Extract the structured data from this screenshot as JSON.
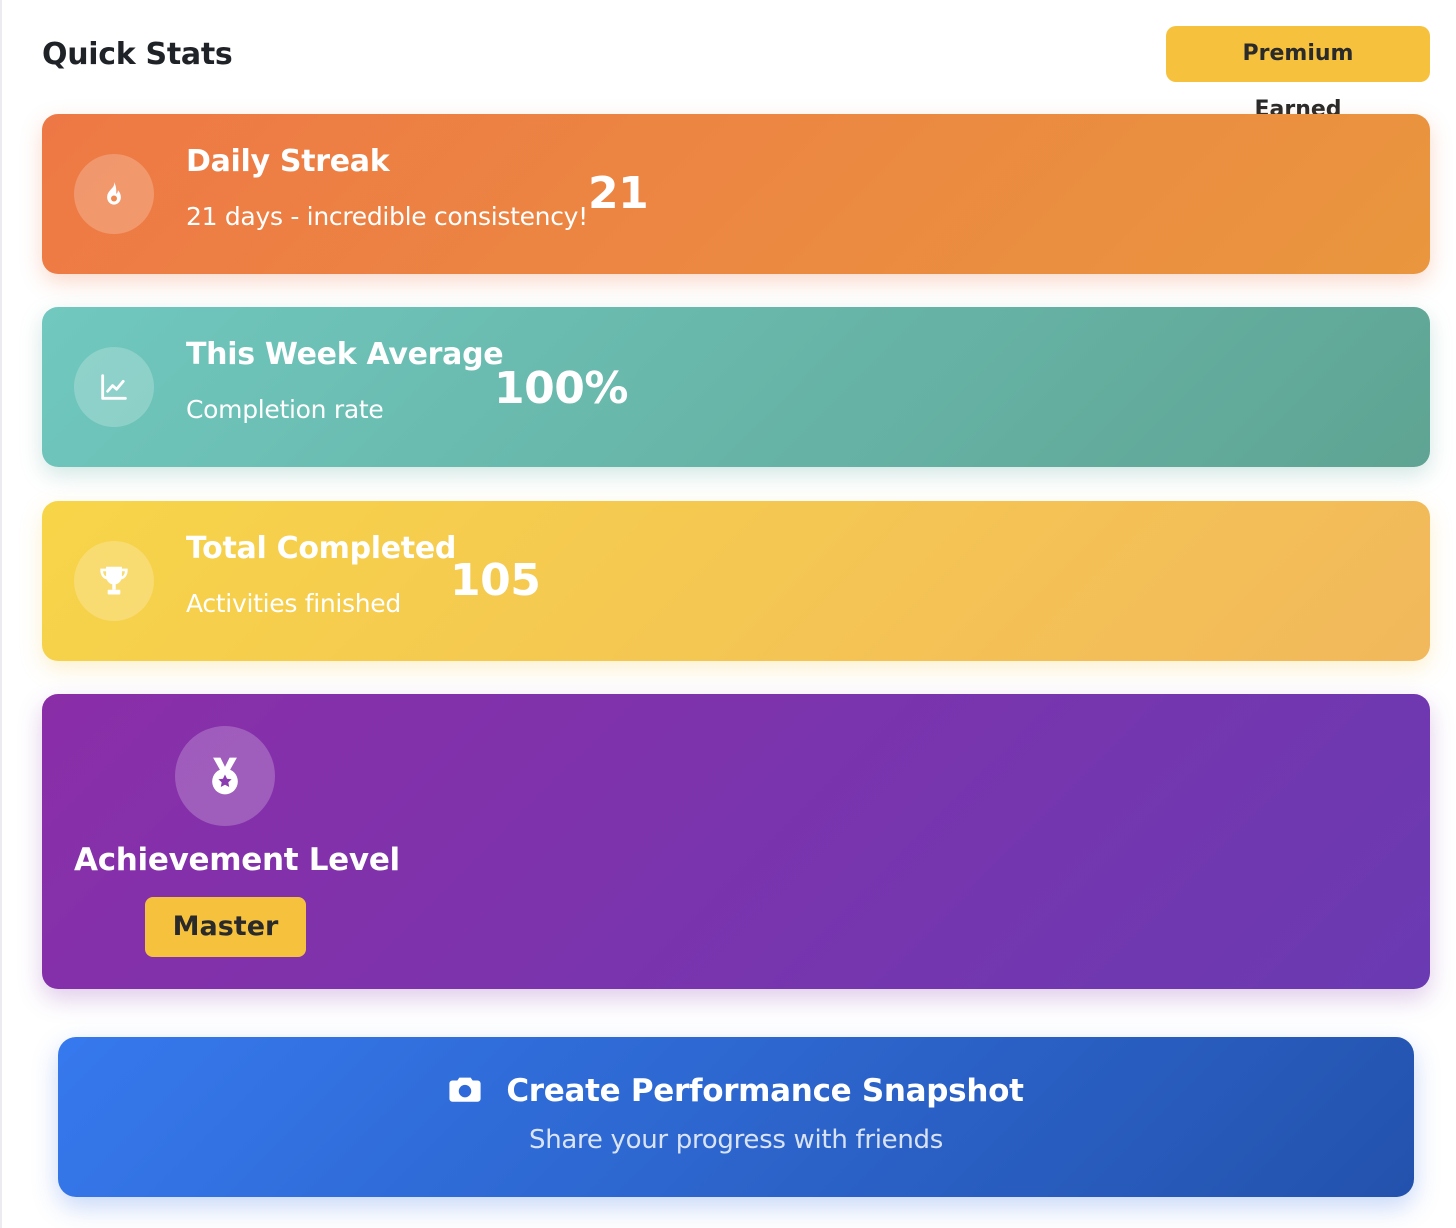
{
  "header": {
    "title": "Quick Stats",
    "premium_badge": "Premium Earned"
  },
  "stats": [
    {
      "title": "Daily Streak",
      "subtitle": "21 days - incredible consistency!",
      "value": "21",
      "icon": "fire-icon",
      "color": "#ee7845"
    },
    {
      "title": "This Week Average",
      "subtitle": "Completion rate",
      "value": "100%",
      "icon": "chart-line-icon",
      "color": "#70c8bf"
    },
    {
      "title": "Total Completed",
      "subtitle": "Activities finished",
      "value": "105",
      "icon": "trophy-icon",
      "color": "#f7d548"
    }
  ],
  "achievement": {
    "title": "Achievement Level",
    "level": "Master",
    "icon": "medal-icon",
    "color": "#8a2ea8"
  },
  "snapshot": {
    "label": "Create Performance Snapshot",
    "subtitle": "Share your progress with friends",
    "icon": "camera-icon",
    "color": "#3679ee"
  },
  "colors": {
    "badge": "#f6c23e"
  }
}
